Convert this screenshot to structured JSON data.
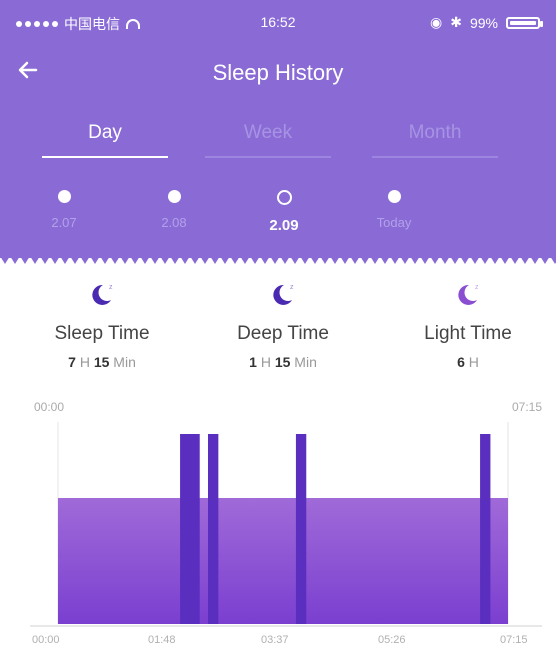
{
  "status_bar": {
    "carrier": "中国电信",
    "time": "16:52",
    "battery": "99%"
  },
  "navbar": {
    "title": "Sleep History",
    "back_icon": "arrow-left-icon"
  },
  "tabs": [
    {
      "label": "Day",
      "active": true
    },
    {
      "label": "Week",
      "active": false
    },
    {
      "label": "Month",
      "active": false
    }
  ],
  "days": [
    {
      "label": "2.07",
      "active": false
    },
    {
      "label": "2.08",
      "active": false
    },
    {
      "label": "2.09",
      "active": true
    },
    {
      "label": "Today",
      "active": false
    }
  ],
  "stats": [
    {
      "title": "Sleep Time",
      "value_parts": [
        "7",
        " H ",
        "15",
        " Min"
      ],
      "icon": "moon-icon"
    },
    {
      "title": "Deep Time",
      "value_parts": [
        "1",
        " H ",
        "15",
        " Min"
      ],
      "icon": "moon-icon"
    },
    {
      "title": "Light Time",
      "value_parts": [
        "6",
        " H"
      ],
      "icon": "moon-icon"
    }
  ],
  "chart": {
    "start_label": "00:00",
    "end_label": "07:15",
    "x_ticks": [
      "00:00",
      "01:48",
      "03:37",
      "05:26",
      "07:15"
    ]
  },
  "chart_data": {
    "type": "bar",
    "x_range_minutes": [
      0,
      435
    ],
    "light_sleep_span": [
      0,
      435
    ],
    "deep_sleep_intervals": [
      [
        118,
        137
      ],
      [
        145,
        155
      ],
      [
        230,
        240
      ],
      [
        408,
        418
      ]
    ]
  },
  "colors": {
    "header": "#8a6bd6",
    "deep": "#5a2fbf",
    "light_top": "#a06ad8",
    "light_bottom": "#7b3fd0"
  }
}
